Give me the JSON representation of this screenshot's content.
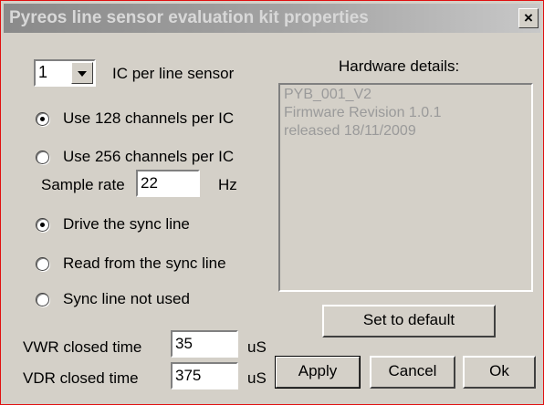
{
  "window": {
    "title": "Pyreos line sensor evaluation kit properties",
    "close_label": "×"
  },
  "ic_per_sensor": {
    "value": "1",
    "label": "IC per line sensor"
  },
  "channels": {
    "options": [
      {
        "label": "Use 128 channels per IC",
        "checked": true
      },
      {
        "label": "Use 256 channels per IC",
        "checked": false
      }
    ]
  },
  "sample_rate": {
    "label": "Sample rate",
    "value": "22",
    "unit": "Hz"
  },
  "sync": {
    "options": [
      {
        "label": "Drive the sync line",
        "checked": true
      },
      {
        "label": "Read from the sync line",
        "checked": false
      },
      {
        "label": "Sync line not used",
        "checked": false
      }
    ]
  },
  "vwr": {
    "label": "VWR closed time",
    "value": "35",
    "unit": "uS"
  },
  "vdr": {
    "label": "VDR closed time",
    "value": "375",
    "unit": "uS"
  },
  "hardware": {
    "heading": "Hardware details:",
    "lines": [
      "PYB_001_V2",
      "Firmware Revision 1.0.1",
      "released 18/11/2009"
    ]
  },
  "buttons": {
    "set_default": "Set to default",
    "apply": "Apply",
    "cancel": "Cancel",
    "ok": "Ok"
  }
}
